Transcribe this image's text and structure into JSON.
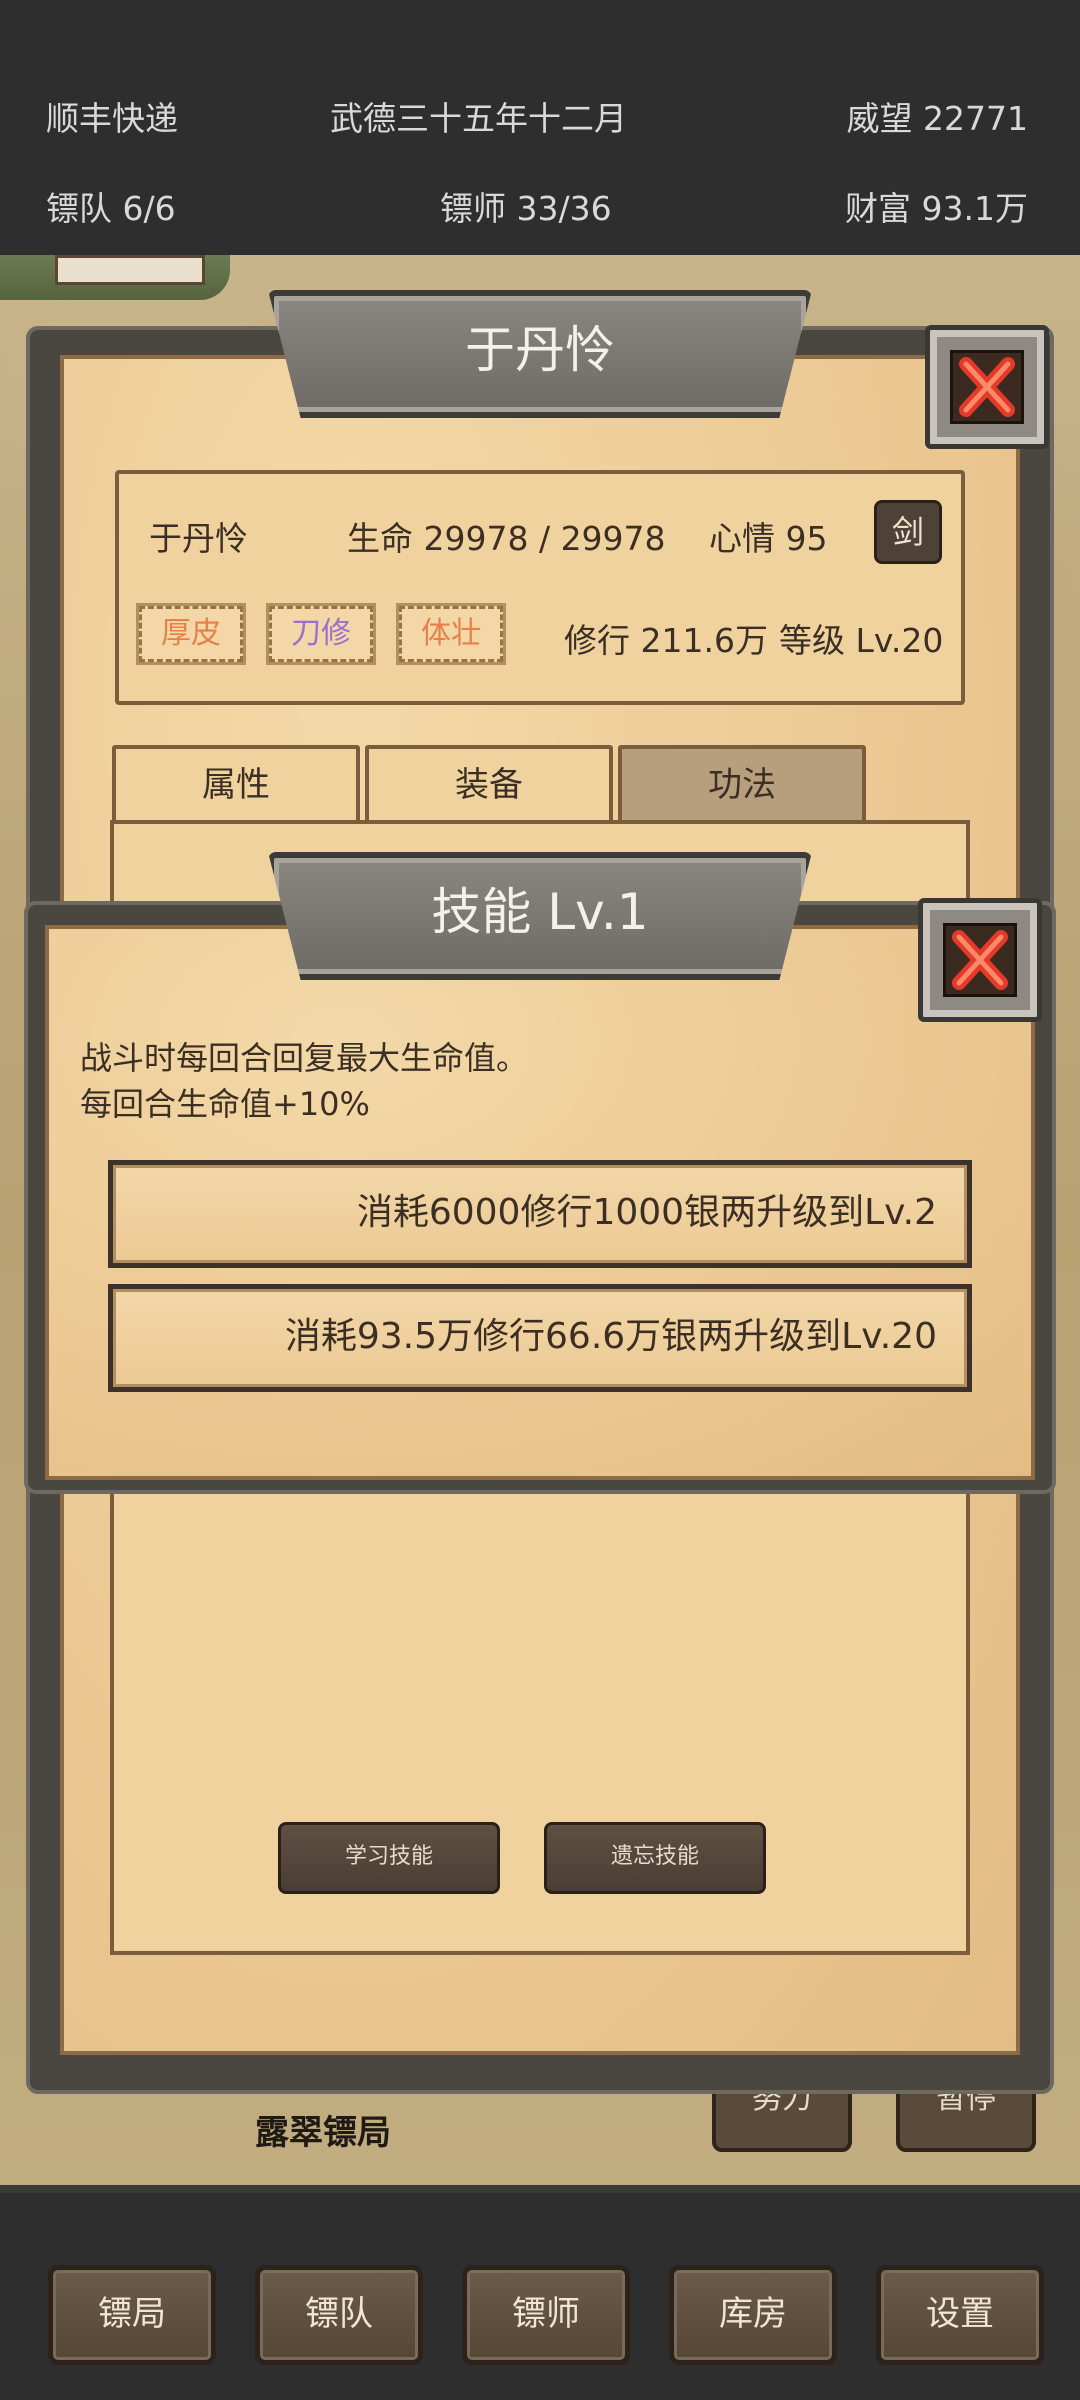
{
  "status_bar": {
    "company": "顺丰快递",
    "date": "武德三十五年十二月",
    "prestige": "威望 22771",
    "teams": "镖队 6/6",
    "guards": "镖师 33/36",
    "wealth": "财富  93.1万"
  },
  "map": {
    "location_label": "露翠镖局",
    "button_1": "努力",
    "button_2": "暂停"
  },
  "guard_window": {
    "title": "于丹怜",
    "name": "于丹怜",
    "life": "生命 29978 / 29978",
    "mood": "心情 95",
    "weapon_button": "剑",
    "traits": [
      {
        "label": "厚皮",
        "color": "#e5804a"
      },
      {
        "label": "刀修",
        "color": "#9b6fd0"
      },
      {
        "label": "体壮",
        "color": "#e5804a"
      }
    ],
    "cultivation": "修行 211.6万",
    "level": "等级 Lv.20",
    "tabs": [
      "属性",
      "装备",
      "功法"
    ],
    "active_tab": "功法",
    "learn_button": "学习技能",
    "forget_button": "遗忘技能"
  },
  "skill_popup": {
    "title": "技能 Lv.1",
    "description_line1": "战斗时每回合回复最大生命值。",
    "description_line2": "每回合生命值+10%",
    "upgrade_next": "消耗6000修行1000银两升级到Lv.2",
    "upgrade_max": "消耗93.5万修行66.6万银两升级到Lv.20"
  },
  "bottom_nav": [
    "镖局",
    "镖队",
    "镖师",
    "库房",
    "设置"
  ]
}
